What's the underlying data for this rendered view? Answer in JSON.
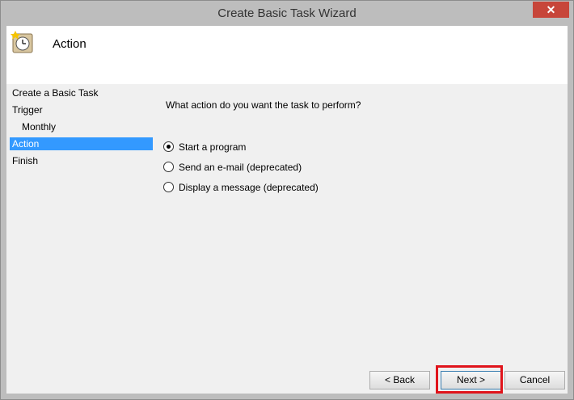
{
  "window": {
    "title": "Create Basic Task Wizard",
    "close_glyph": "✕"
  },
  "header": {
    "title": "Action",
    "icon": "task-clock-icon"
  },
  "nav": {
    "items": [
      {
        "label": "Create a Basic Task"
      },
      {
        "label": "Trigger"
      },
      {
        "label": "Monthly"
      },
      {
        "label": "Action"
      },
      {
        "label": "Finish"
      }
    ]
  },
  "main": {
    "question": "What action do you want the task to perform?",
    "options": [
      {
        "label": "Start a program",
        "selected": true
      },
      {
        "label": "Send an e-mail (deprecated)",
        "selected": false
      },
      {
        "label": "Display a message (deprecated)",
        "selected": false
      }
    ]
  },
  "buttons": {
    "back_label": "< Back",
    "next_label": "Next >",
    "cancel_label": "Cancel"
  },
  "colors": {
    "selection": "#3399ff",
    "highlight_box": "#e0141b"
  }
}
